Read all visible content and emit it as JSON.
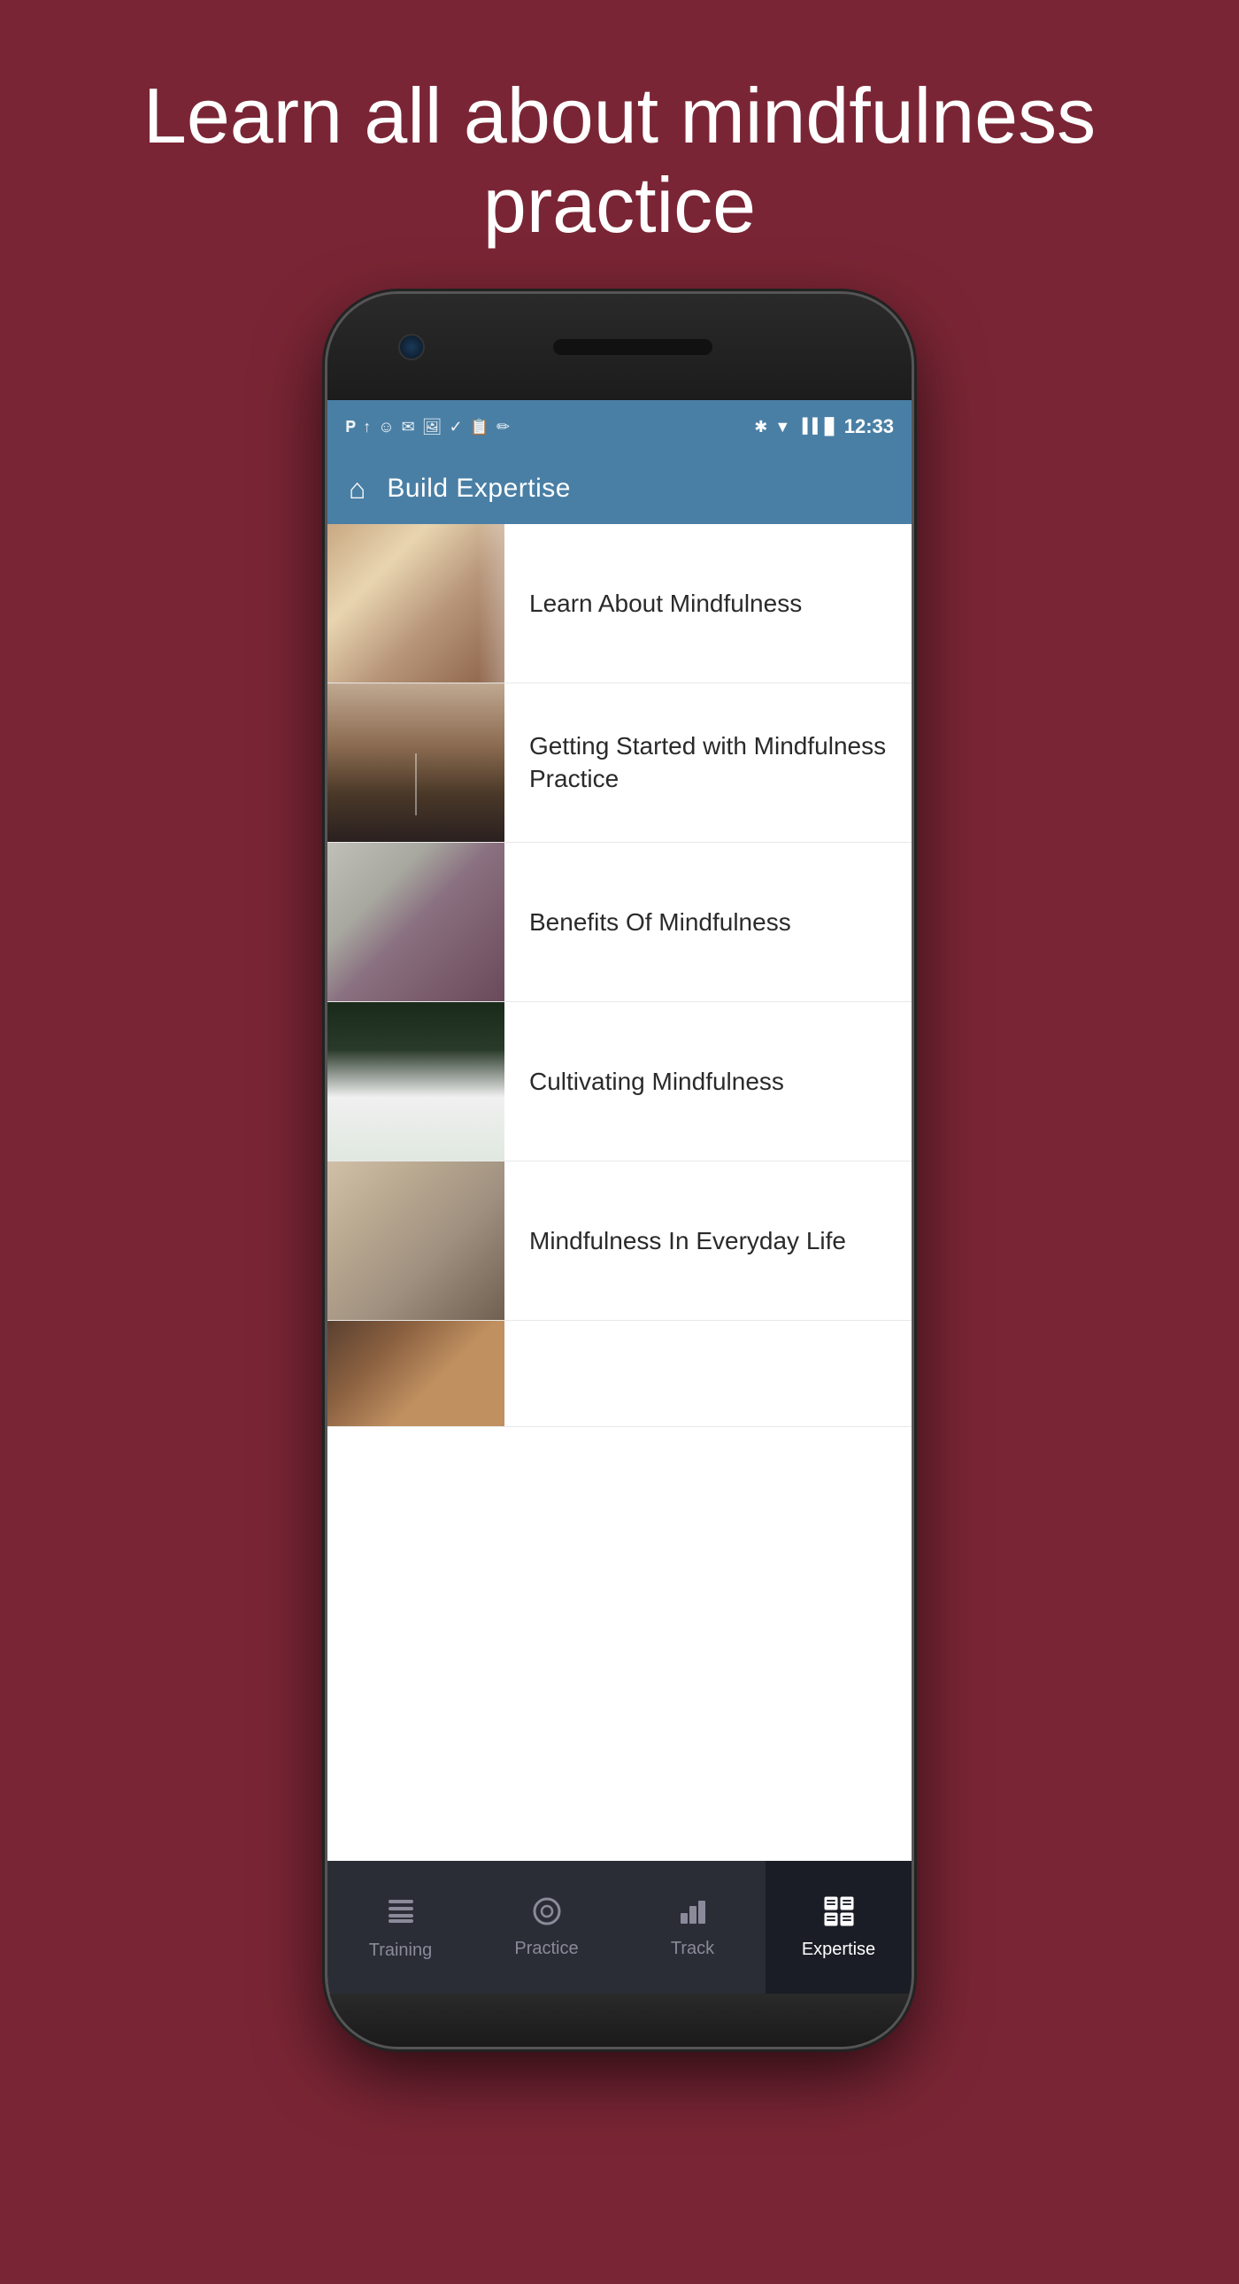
{
  "background": {
    "color": "#7a2535"
  },
  "hero": {
    "text": "Learn all about mindfulness practice"
  },
  "status_bar": {
    "icons_left": [
      "P",
      "↑",
      "☺",
      "✉",
      "🖼",
      "✓",
      "📋",
      "✏"
    ],
    "bluetooth": "⚡",
    "wifi": "▼",
    "signal": "▶",
    "battery": "🔋",
    "time": "12:33"
  },
  "app_bar": {
    "title": "Build Expertise",
    "home_icon": "⌂"
  },
  "list_items": [
    {
      "id": "learn-mindfulness",
      "label": "Learn About Mindfulness",
      "thumbnail_type": "book"
    },
    {
      "id": "getting-started",
      "label": "Getting Started with Mindfulness Practice",
      "thumbnail_type": "yoga"
    },
    {
      "id": "benefits",
      "label": "Benefits Of Mindfulness",
      "thumbnail_type": "flowers"
    },
    {
      "id": "cultivating",
      "label": "Cultivating Mindfulness",
      "thumbnail_type": "lotus"
    },
    {
      "id": "everyday-life",
      "label": "Mindfulness In Everyday Life",
      "thumbnail_type": "hands"
    },
    {
      "id": "partial",
      "label": "",
      "thumbnail_type": "bottom"
    }
  ],
  "bottom_nav": {
    "items": [
      {
        "id": "training",
        "label": "Training",
        "icon": "☰",
        "active": false
      },
      {
        "id": "practice",
        "label": "Practice",
        "icon": "◎",
        "active": false
      },
      {
        "id": "track",
        "label": "Track",
        "icon": "📊",
        "active": false
      },
      {
        "id": "expertise",
        "label": "Expertise",
        "icon": "⊞",
        "active": true
      }
    ]
  }
}
